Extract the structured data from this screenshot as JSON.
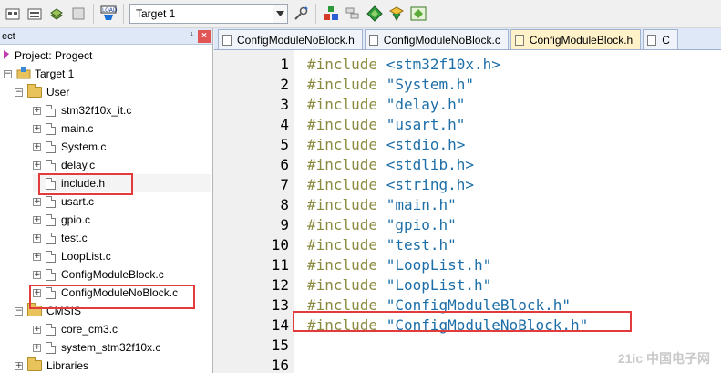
{
  "toolbar": {
    "target": "Target 1",
    "icons": [
      "translate-icon",
      "build-icon",
      "batch-build-icon",
      "rebuild-icon",
      "load-icon",
      "options-icon",
      "manage-components-icon",
      "extension-icon",
      "diamond-icon",
      "pack-icon"
    ]
  },
  "project": {
    "header_title": "ect",
    "pin_glyph": "¹",
    "close_glyph": "×",
    "root": "Project: Progect",
    "target": "Target 1",
    "groups": [
      {
        "name": "User",
        "files": [
          "stm32f10x_it.c",
          "main.c",
          "System.c",
          "delay.c",
          "include.h",
          "usart.c",
          "gpio.c",
          "test.c",
          "LoopList.c",
          "ConfigModuleBlock.c",
          "ConfigModuleNoBlock.c"
        ]
      },
      {
        "name": "CMSIS",
        "files": [
          "core_cm3.c",
          "system_stm32f10x.c"
        ]
      },
      {
        "name": "Libraries",
        "files": []
      }
    ]
  },
  "tabs": [
    {
      "label": "ConfigModuleNoBlock.h",
      "active": false
    },
    {
      "label": "ConfigModuleNoBlock.c",
      "active": false
    },
    {
      "label": "ConfigModuleBlock.h",
      "active": true
    },
    {
      "label": "C",
      "active": false
    }
  ],
  "code": [
    {
      "num": "1",
      "kw": "#include",
      "arg": " <stm32f10x.h>"
    },
    {
      "num": "2",
      "kw": "#include",
      "arg": " \"System.h\""
    },
    {
      "num": "3",
      "kw": "#include",
      "arg": " \"delay.h\""
    },
    {
      "num": "4",
      "kw": "#include",
      "arg": " \"usart.h\""
    },
    {
      "num": "5",
      "kw": "#include",
      "arg": " <stdio.h>"
    },
    {
      "num": "6",
      "kw": "#include",
      "arg": " <stdlib.h>"
    },
    {
      "num": "7",
      "kw": "#include",
      "arg": " <string.h>"
    },
    {
      "num": "8",
      "kw": "#include",
      "arg": " \"main.h\""
    },
    {
      "num": "9",
      "kw": "#include",
      "arg": " \"gpio.h\""
    },
    {
      "num": "10",
      "kw": "#include",
      "arg": " \"test.h\""
    },
    {
      "num": "11",
      "kw": "#include",
      "arg": " \"LoopList.h\""
    },
    {
      "num": "12",
      "kw": "#include",
      "arg": " \"LoopList.h\""
    },
    {
      "num": "13",
      "kw": "#include",
      "arg": " \"ConfigModuleBlock.h\""
    },
    {
      "num": "14",
      "kw": "#include",
      "arg": " \"ConfigModuleNoBlock.h\""
    },
    {
      "num": "15",
      "kw": "",
      "arg": ""
    },
    {
      "num": "16",
      "kw": "",
      "arg": ""
    }
  ],
  "watermark": "21ic 中国电子网",
  "colors": {
    "highlight": "#e23b3b",
    "keyword": "#8b8b40",
    "string": "#1c6ea8"
  }
}
